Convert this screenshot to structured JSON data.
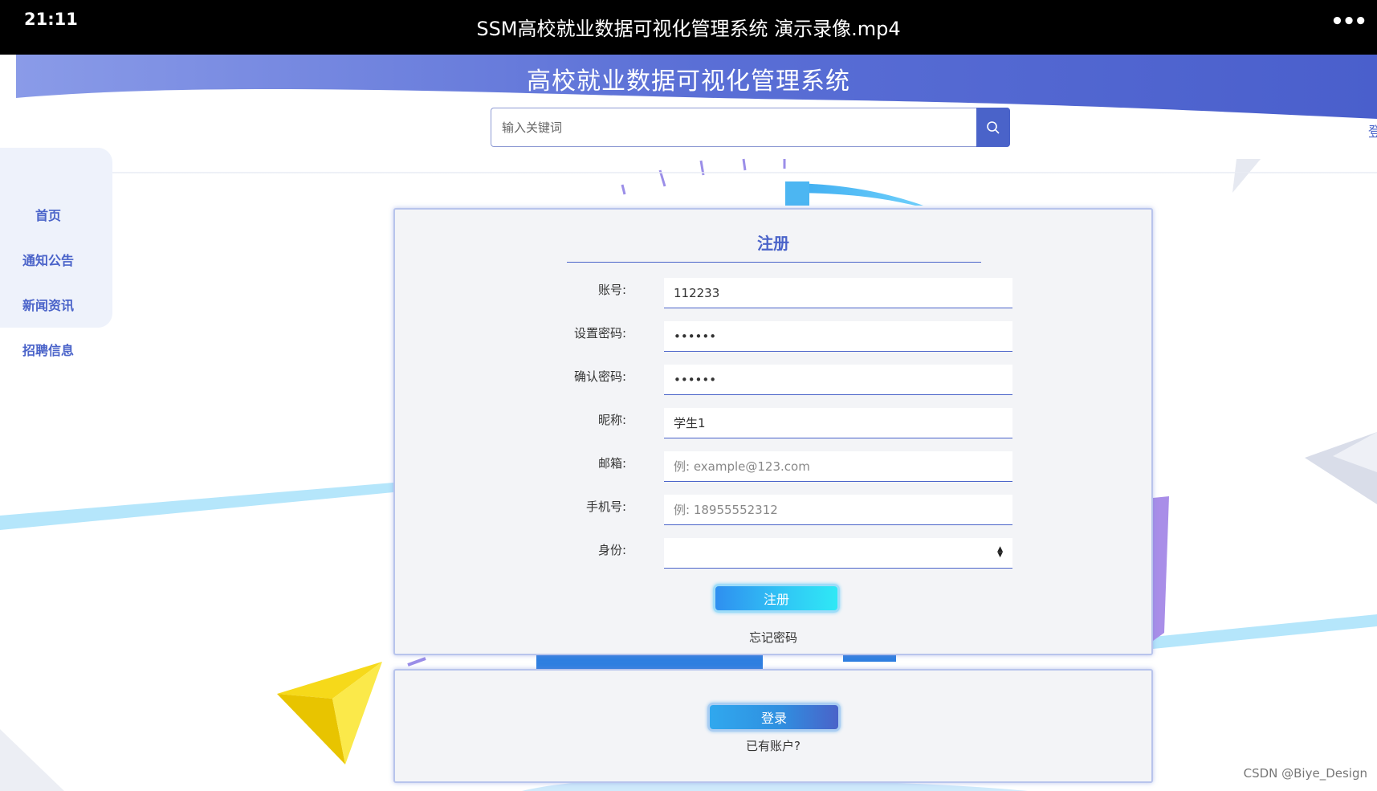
{
  "player": {
    "time": "21:11",
    "title": "SSM高校就业数据可视化管理系统 演示录像.mp4",
    "more_glyph": "•••"
  },
  "header": {
    "site_title": "高校就业数据可视化管理系统",
    "search": {
      "placeholder": "输入关键词",
      "value": "",
      "icon": "search-icon"
    },
    "right_edge_text": "登"
  },
  "nav": {
    "items": [
      {
        "label": "首页"
      },
      {
        "label": "通知公告"
      },
      {
        "label": "新闻资讯"
      },
      {
        "label": "招聘信息"
      }
    ]
  },
  "register": {
    "title": "注册",
    "fields": [
      {
        "label": "账号:",
        "value": "112233",
        "placeholder": "",
        "type": "text"
      },
      {
        "label": "设置密码:",
        "value": "••••••",
        "placeholder": "",
        "type": "password"
      },
      {
        "label": "确认密码:",
        "value": "••••••",
        "placeholder": "",
        "type": "password"
      },
      {
        "label": "昵称:",
        "value": "学生1",
        "placeholder": "",
        "type": "text"
      },
      {
        "label": "邮箱:",
        "value": "",
        "placeholder": "例: example@123.com",
        "type": "text"
      },
      {
        "label": "手机号:",
        "value": "",
        "placeholder": "例: 18955552312",
        "type": "text"
      },
      {
        "label": "身份:",
        "value": "",
        "placeholder": "",
        "type": "select"
      }
    ],
    "submit_label": "注册",
    "forgot_label": "忘记密码"
  },
  "login": {
    "button_label": "登录",
    "has_account_label": "已有账户?"
  },
  "watermark": "CSDN @Biye_Design",
  "colors": {
    "accent": "#4a63c9",
    "header_band": "#5a6fd6",
    "register_button": "#30c9f5",
    "login_button": "#2f8fe0"
  }
}
